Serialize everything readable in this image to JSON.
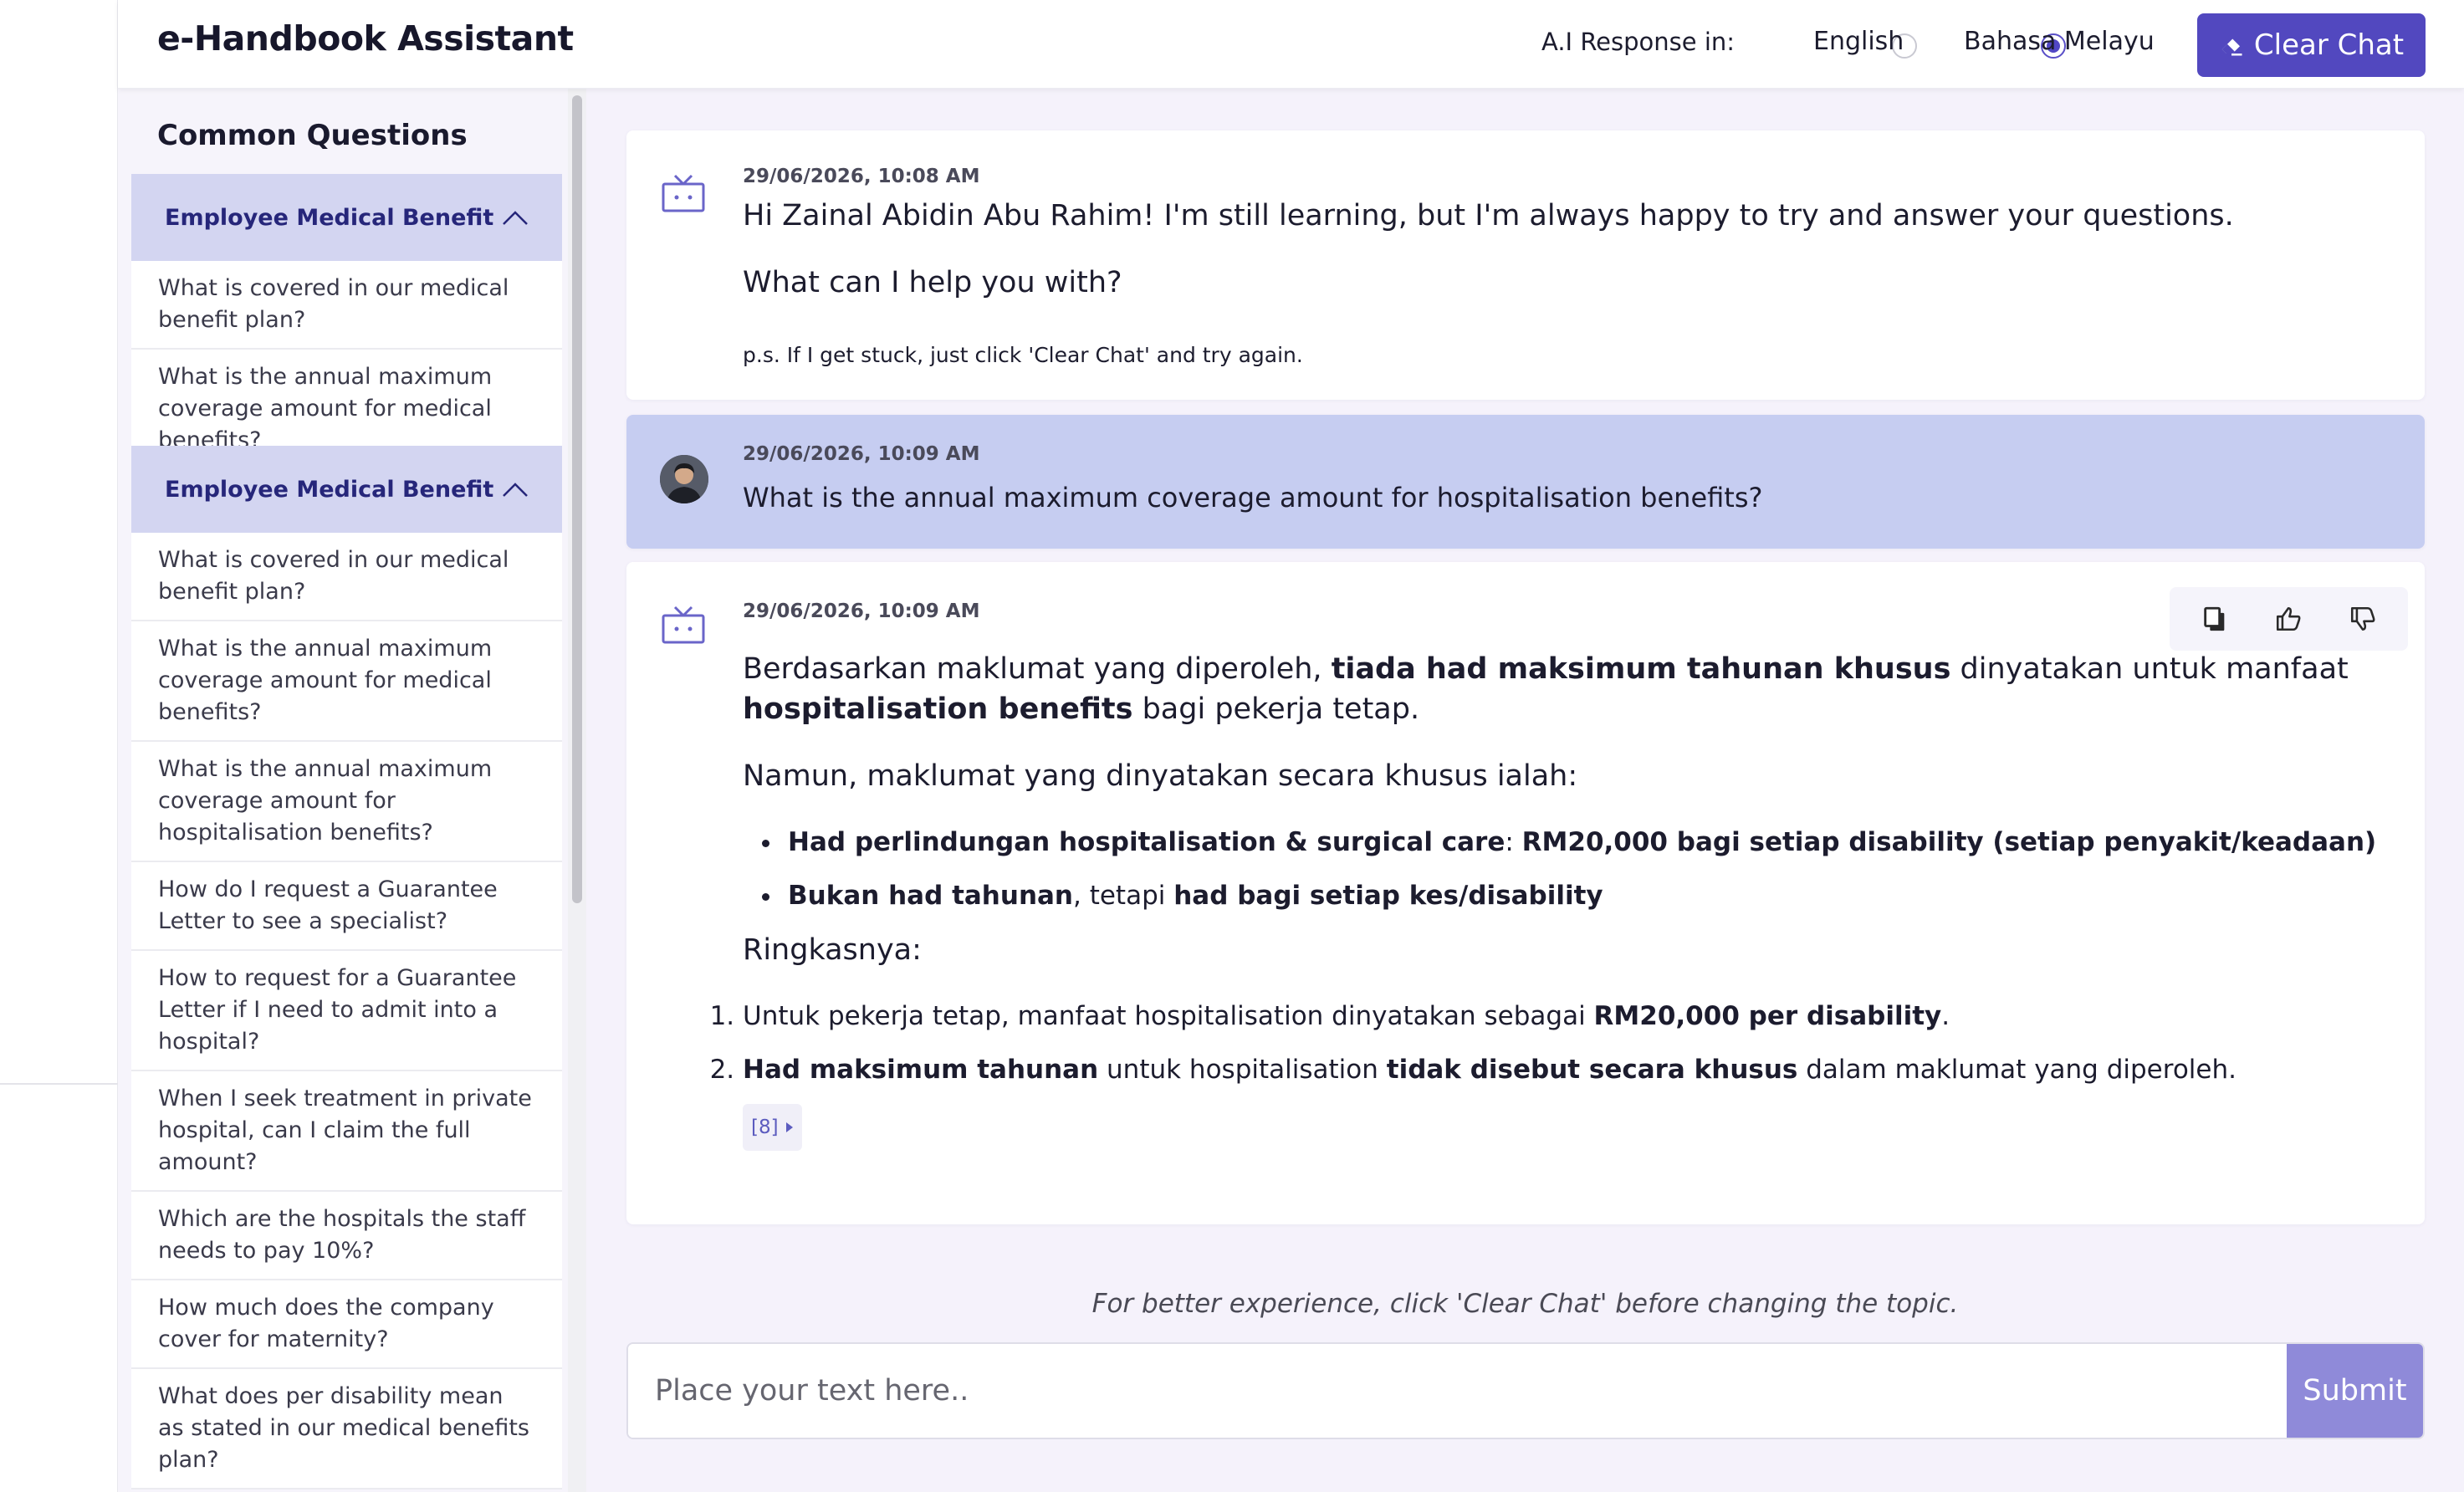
{
  "header": {
    "title": "e-Handbook Assistant",
    "response_label": "A.I Response in:",
    "lang_english": "English",
    "lang_malay": "Bahasa Melayu",
    "selected_language": "Bahasa Melayu",
    "clear_chat": "Clear Chat"
  },
  "sidebar": {
    "title": "Common Questions",
    "groups": [
      {
        "label": "Employee Medical Benefit",
        "items": [
          "What is covered in our medical benefit plan?",
          "What is the annual maximum coverage amount for medical benefits?"
        ]
      },
      {
        "label": "Employee Medical Benefit",
        "items": [
          "What is covered in our medical benefit plan?",
          "What is the annual maximum coverage amount for medical benefits?",
          "What is the annual maximum coverage amount for hospitalisation benefits?",
          "How do I request a Guarantee Letter to see a specialist?",
          "How to request for a Guarantee Letter if I need to admit into a hospital?",
          "When I seek treatment in private hospital, can I claim the full amount?",
          "Which are the hospitals the staff needs to pay 10%?",
          "How much does the company cover for maternity?",
          "What does per disability mean as stated in our medical benefits plan?"
        ]
      }
    ]
  },
  "chat": {
    "messages": [
      {
        "role": "assistant",
        "timestamp": "29/06/2026, 10:08 AM",
        "line1": "Hi Zainal Abidin Abu Rahim! I'm still learning, but I'm always happy to try and answer your questions.",
        "line2": "What can I help you with?",
        "note": "p.s. If I get stuck, just click 'Clear Chat' and try again."
      },
      {
        "role": "user",
        "timestamp": "29/06/2026, 10:09 AM",
        "text": "What is the annual maximum coverage amount for hospitalisation benefits?"
      },
      {
        "role": "assistant",
        "timestamp": "29/06/2026, 10:09 AM",
        "p1": {
          "a": "Berdasarkan maklumat yang diperoleh, ",
          "b": "tiada had maksimum tahunan khusus",
          "c": " dinyatakan untuk manfaat ",
          "d": "hospitalisation benefits",
          "e": " bagi pekerja tetap."
        },
        "p2": "Namun, maklumat yang dinyatakan secara khusus ialah:",
        "bullet1": {
          "a": "Had perlindungan hospitalisation & surgical care",
          "b": ": ",
          "c": "RM20,000 bagi setiap disability (setiap penyakit/keadaan)"
        },
        "bullet2": {
          "a": "Bukan had tahunan",
          "b": ", tetapi ",
          "c": "had bagi setiap kes/disability"
        },
        "p3": "Ringkasnya:",
        "item1": {
          "a": "Untuk pekerja tetap, manfaat hospitalisation dinyatakan sebagai ",
          "b": "RM20,000 per disability",
          "c": "."
        },
        "item2": {
          "a": "Had maksimum tahunan",
          "b": " untuk hospitalisation ",
          "c": "tidak disebut secara khusus",
          "d": " dalam maklumat yang diperoleh."
        },
        "reference": "[8]"
      }
    ],
    "hint": "For better experience, click 'Clear Chat' before changing the topic.",
    "input_placeholder": "Place your text here..",
    "submit_label": "Submit"
  },
  "colors": {
    "accent": "#5248bf",
    "user_bubble": "#c6cdf1",
    "accordion_header": "#d3d5f1",
    "submit": "#8f8ad9",
    "main_bg": "#f5f2fb"
  }
}
